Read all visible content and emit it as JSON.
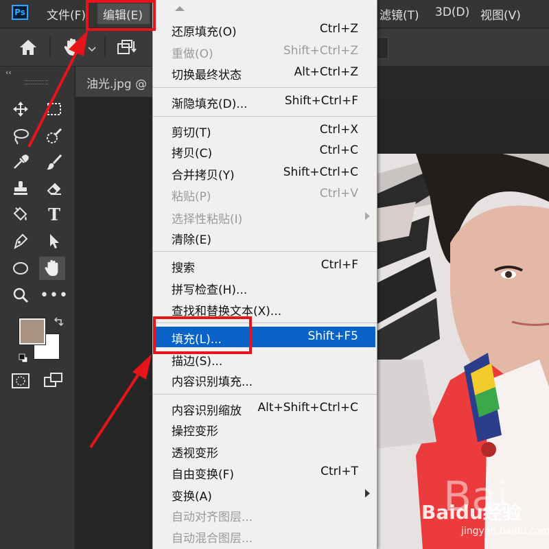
{
  "app": {
    "logo": "Ps"
  },
  "menubar": {
    "items": [
      {
        "label": "文件(F)"
      },
      {
        "label": "编辑(E)"
      },
      {
        "label": "滤镜(T)"
      },
      {
        "label": "3D(D)"
      },
      {
        "label": "视图(V)"
      }
    ]
  },
  "document": {
    "title": "油光.jpg @"
  },
  "edit_menu": {
    "items": [
      {
        "label": "还原填充(O)",
        "shortcut": "Ctrl+Z",
        "enabled": true
      },
      {
        "label": "重做(O)",
        "shortcut": "Shift+Ctrl+Z",
        "enabled": false
      },
      {
        "label": "切换最终状态",
        "shortcut": "Alt+Ctrl+Z",
        "enabled": true
      },
      {
        "label": "渐隐填充(D)...",
        "shortcut": "Shift+Ctrl+F",
        "enabled": true
      },
      {
        "label": "剪切(T)",
        "shortcut": "Ctrl+X",
        "enabled": true
      },
      {
        "label": "拷贝(C)",
        "shortcut": "Ctrl+C",
        "enabled": true
      },
      {
        "label": "合并拷贝(Y)",
        "shortcut": "Shift+Ctrl+C",
        "enabled": true
      },
      {
        "label": "粘贴(P)",
        "shortcut": "Ctrl+V",
        "enabled": false
      },
      {
        "label": "选择性粘贴(I)",
        "shortcut": "",
        "enabled": false,
        "submenu": true
      },
      {
        "label": "清除(E)",
        "shortcut": "",
        "enabled": true
      },
      {
        "label": "搜索",
        "shortcut": "Ctrl+F",
        "enabled": true
      },
      {
        "label": "拼写检查(H)...",
        "shortcut": "",
        "enabled": true
      },
      {
        "label": "查找和替换文本(X)...",
        "shortcut": "",
        "enabled": true
      },
      {
        "label": "填充(L)...",
        "shortcut": "Shift+F5",
        "enabled": true,
        "highlighted": true
      },
      {
        "label": "描边(S)...",
        "shortcut": "",
        "enabled": true
      },
      {
        "label": "内容识别填充...",
        "shortcut": "",
        "enabled": true
      },
      {
        "label": "内容识别缩放",
        "shortcut": "Alt+Shift+Ctrl+C",
        "enabled": true
      },
      {
        "label": "操控变形",
        "shortcut": "",
        "enabled": true
      },
      {
        "label": "透视变形",
        "shortcut": "",
        "enabled": true
      },
      {
        "label": "自由变换(F)",
        "shortcut": "Ctrl+T",
        "enabled": true
      },
      {
        "label": "变换(A)",
        "shortcut": "",
        "enabled": true,
        "submenu": true
      },
      {
        "label": "自动对齐图层...",
        "shortcut": "",
        "enabled": false
      },
      {
        "label": "自动混合图层...",
        "shortcut": "",
        "enabled": false
      }
    ]
  },
  "colors": {
    "foreground": "#a89282",
    "background": "#ffffff",
    "highlight": "#0a64c8",
    "annotation": "#e8141c"
  },
  "watermark": {
    "brand": "Baidu经验",
    "url": "jingyan.baidu.com"
  }
}
